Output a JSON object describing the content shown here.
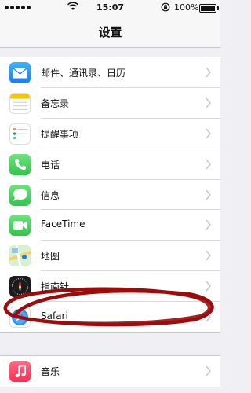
{
  "status_bar": {
    "time": "15:07",
    "battery_text": "100%"
  },
  "nav": {
    "title": "设置"
  },
  "groups": [
    {
      "items": [
        {
          "label": "邮件、通讯录、日历",
          "icon": "mail-icon",
          "color": "#1a8cff"
        },
        {
          "label": "备忘录",
          "icon": "notes-icon",
          "color": "#ffffff"
        },
        {
          "label": "提醒事项",
          "icon": "reminders-icon",
          "color": "#ffffff"
        },
        {
          "label": "电话",
          "icon": "phone-icon",
          "color": "#4cd964"
        },
        {
          "label": "信息",
          "icon": "messages-icon",
          "color": "#4cd964"
        },
        {
          "label": "FaceTime",
          "icon": "facetime-icon",
          "color": "#4cd964"
        },
        {
          "label": "地图",
          "icon": "maps-icon",
          "color": "#9fd4a3"
        },
        {
          "label": "指南针",
          "icon": "compass-icon",
          "color": "#1c1c1c"
        },
        {
          "label": "Safari",
          "icon": "safari-icon",
          "color": "#1e90ff"
        }
      ]
    },
    {
      "items": [
        {
          "label": "音乐",
          "icon": "music-icon",
          "color": "#ff3b5c"
        }
      ]
    }
  ],
  "colors": {
    "background": "#efeff4",
    "annotation_stroke": "#9b0d0d",
    "chevron": "#c7c7cc"
  }
}
